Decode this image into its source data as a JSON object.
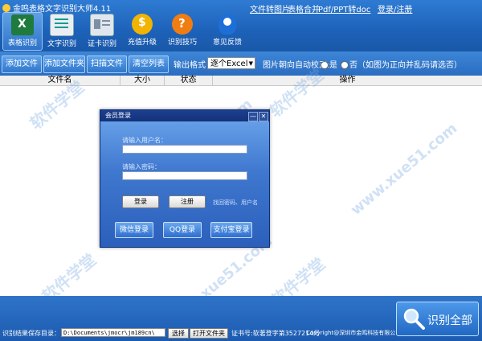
{
  "app": {
    "title": "金鸣表格文字识别大师4.11"
  },
  "top_links": [
    "文件转图片",
    "表格合并",
    "Pdf/PPT转doc",
    "登录/注册"
  ],
  "tools": [
    {
      "label": "表格识别",
      "icon": "excel-icon",
      "active": true
    },
    {
      "label": "文字识别",
      "icon": "document-icon",
      "active": false
    },
    {
      "label": "证卡识别",
      "icon": "id-card-icon",
      "active": false
    },
    {
      "label": "充值升级",
      "icon": "coin-icon",
      "active": false
    },
    {
      "label": "识别技巧",
      "icon": "help-icon",
      "active": false
    },
    {
      "label": "意见反馈",
      "icon": "feedback-icon",
      "active": false
    }
  ],
  "toolbar": {
    "add_file": "添加文件",
    "add_folder": "添加文件夹",
    "scan_file": "扫描文件",
    "clear_list": "清空列表",
    "output_format_label": "输出格式",
    "output_format_value": "逐个Excel",
    "orientation_label": "图片朝向自动校正:",
    "opt_yes": "是",
    "opt_no": "否（如图为正向并乱码请选否）"
  },
  "table": {
    "columns": [
      "文件名",
      "大小",
      "状态",
      "操作"
    ]
  },
  "watermark": {
    "text1": "软件学堂",
    "text2": "www.xue51.com"
  },
  "login_dialog": {
    "title": "会员登录",
    "minimize": "—",
    "close": "✕",
    "username_placeholder": "请输入用户名：",
    "password_placeholder": "请输入密码：",
    "login_button": "登录",
    "register_button": "注册",
    "forgot_link": "找回密码、用户名",
    "wechat_login": "微信登录",
    "qq_login": "QQ登录",
    "alipay_login": "支付宝登录"
  },
  "statusbar": {
    "save_dir_label": "识别结果保存目录：",
    "save_dir_value": "D:\\Documents\\jmocr\\jm189cn\\",
    "select_button": "选择",
    "open_folder_button": "打开文件夹",
    "cert_text": "证书号:软著登字第3527214号",
    "copyright_text": "Copyright@深圳市金鸣科技有限公司",
    "recognize_all": "识别全部"
  }
}
